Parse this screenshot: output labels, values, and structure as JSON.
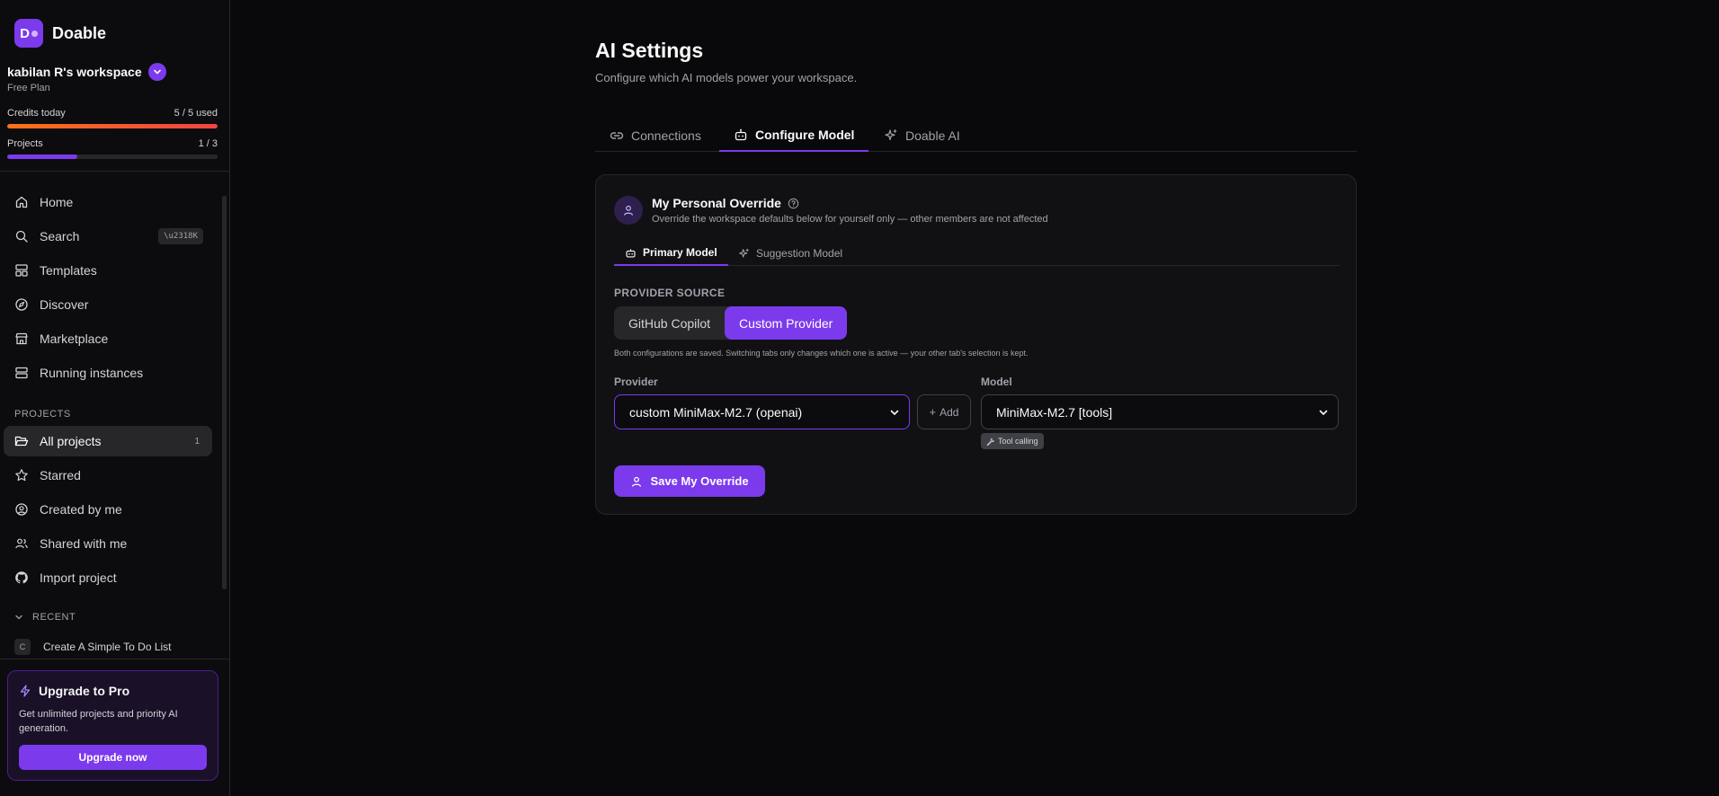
{
  "app": {
    "name": "Doable",
    "logo_letter": "D"
  },
  "workspace": {
    "name": "kabilan R's workspace",
    "plan": "Free Plan"
  },
  "meters": {
    "credits": {
      "label": "Credits today",
      "value": "5 / 5 used",
      "fraction": 1.0
    },
    "projects": {
      "label": "Projects",
      "value": "1 / 3",
      "fraction": 0.333
    }
  },
  "nav": {
    "home": "Home",
    "search": "Search",
    "search_shortcut": "\\u2318K",
    "templates": "Templates",
    "discover": "Discover",
    "marketplace": "Marketplace",
    "running": "Running instances"
  },
  "projects_section": {
    "heading": "PROJECTS",
    "all_projects": "All projects",
    "all_projects_count": "1",
    "starred": "Starred",
    "created_by_me": "Created by me",
    "shared_with_me": "Shared with me",
    "import_project": "Import project"
  },
  "recent": {
    "heading": "RECENT",
    "items": [
      {
        "badge": "C",
        "label": "Create A Simple To Do List"
      }
    ]
  },
  "upgrade": {
    "title": "Upgrade to Pro",
    "text": "Get unlimited projects and priority AI generation.",
    "button": "Upgrade now"
  },
  "page": {
    "title": "AI Settings",
    "subtitle": "Configure which AI models power your workspace."
  },
  "tabs": {
    "connections": "Connections",
    "configure_model": "Configure Model",
    "doable_ai": "Doable AI"
  },
  "override": {
    "title": "My Personal Override",
    "description": "Override the workspace defaults below for yourself only — other members are not affected",
    "subtabs": {
      "primary": "Primary Model",
      "suggestion": "Suggestion Model"
    },
    "provider_source_label": "PROVIDER SOURCE",
    "sources": {
      "github": "GitHub Copilot",
      "custom": "Custom Provider"
    },
    "hint": "Both configurations are saved. Switching tabs only changes which one is active — your other tab's selection is kept.",
    "provider_label": "Provider",
    "provider_value": "custom MiniMax-M2.7 (openai)",
    "add_label": "Add",
    "model_label": "Model",
    "model_value": "MiniMax-M2.7 [tools]",
    "capability": "Tool calling",
    "save_button": "Save My Override"
  },
  "colors": {
    "accent": "#7c3aed",
    "credits_bar": "#ef4444",
    "background": "#09090b"
  }
}
